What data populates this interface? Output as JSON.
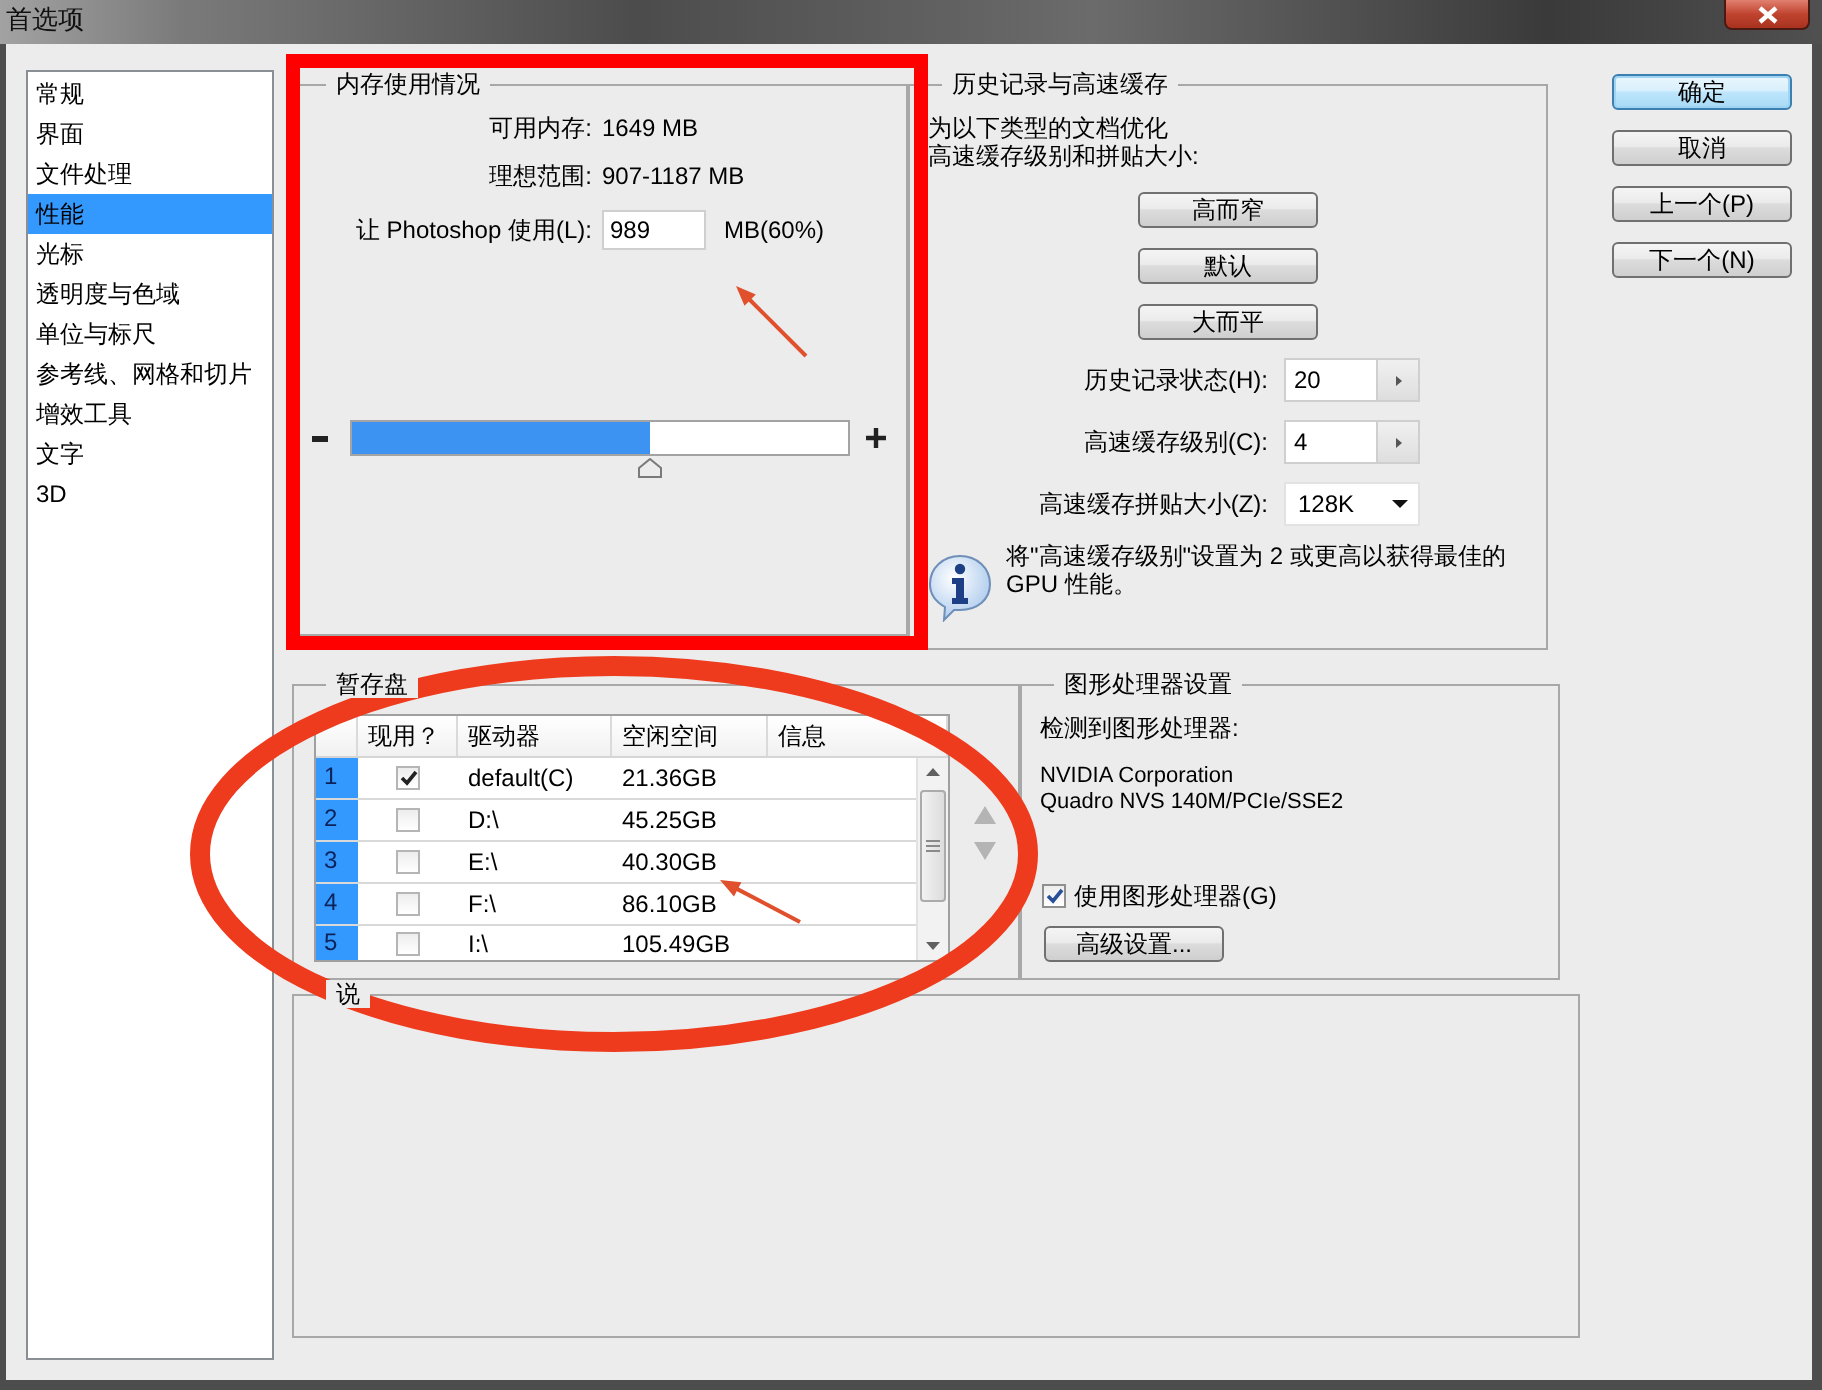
{
  "window": {
    "title": "首选项"
  },
  "sidebar": {
    "items": [
      {
        "label": "常规",
        "selected": false
      },
      {
        "label": "界面",
        "selected": false
      },
      {
        "label": "文件处理",
        "selected": false
      },
      {
        "label": "性能",
        "selected": true
      },
      {
        "label": "光标",
        "selected": false
      },
      {
        "label": "透明度与色域",
        "selected": false
      },
      {
        "label": "单位与标尺",
        "selected": false
      },
      {
        "label": "参考线、网格和切片",
        "selected": false
      },
      {
        "label": "增效工具",
        "selected": false
      },
      {
        "label": "文字",
        "selected": false
      },
      {
        "label": "3D",
        "selected": false
      }
    ]
  },
  "memory": {
    "title": "内存使用情况",
    "available_label": "可用内存:",
    "available_value": "1649 MB",
    "ideal_label": "理想范围:",
    "ideal_value": "907-1187 MB",
    "use_label": "让 Photoshop 使用(L):",
    "use_value": "989",
    "use_unit": "MB(60%)",
    "slider": {
      "level": 0.6
    }
  },
  "history": {
    "title": "历史记录与高速缓存",
    "intro_lines": [
      "为以下类型的文档优化",
      "高速缓存级别和拼贴大小:"
    ],
    "presets": [
      "高而窄",
      "默认",
      "大而平"
    ],
    "fields": [
      {
        "kind": "stepper",
        "label": "历史记录状态(H):",
        "value": "20"
      },
      {
        "kind": "stepper",
        "label": "高速缓存级别(C):",
        "value": "4"
      },
      {
        "kind": "dropdown",
        "label": "高速缓存拼贴大小(Z):",
        "value": "128K"
      }
    ],
    "note": "将\"高速缓存级别\"设置为 2 或更高以获得最佳的GPU 性能。"
  },
  "buttons": [
    {
      "label": "确定",
      "default": true
    },
    {
      "label": "取消",
      "default": false
    },
    {
      "label": "上一个(P)",
      "default": false
    },
    {
      "label": "下一个(N)",
      "default": false
    }
  ],
  "scratch_disks": {
    "title": "暂存盘",
    "columns": [
      "现用？",
      "驱动器",
      "空闲空间",
      "信息"
    ],
    "rows": [
      {
        "number": "1",
        "active": true,
        "drive": "default(C)",
        "free_space": "21.36GB"
      },
      {
        "number": "2",
        "active": false,
        "drive": "D:\\",
        "free_space": "45.25GB"
      },
      {
        "number": "3",
        "active": false,
        "drive": "E:\\",
        "free_space": "40.30GB"
      },
      {
        "number": "4",
        "active": false,
        "drive": "F:\\",
        "free_space": "86.10GB"
      },
      {
        "number": "5",
        "active": false,
        "drive": "I:\\",
        "free_space": "105.49GB"
      }
    ]
  },
  "gpu": {
    "title": "图形处理器设置",
    "detected_label": "检测到图形处理器:",
    "gpu_name": "NVIDIA Corporation\nQuadro NVS 140M/PCIe/SSE2",
    "use_gpu": {
      "label": "使用图形处理器(G)",
      "checked": true
    },
    "advanced_button": "高级设置..."
  },
  "description": {
    "title": "说"
  },
  "annotations": [
    {
      "kind": "rectangle"
    },
    {
      "kind": "ellipse"
    },
    {
      "kind": "arrow"
    },
    {
      "kind": "arrow"
    }
  ]
}
